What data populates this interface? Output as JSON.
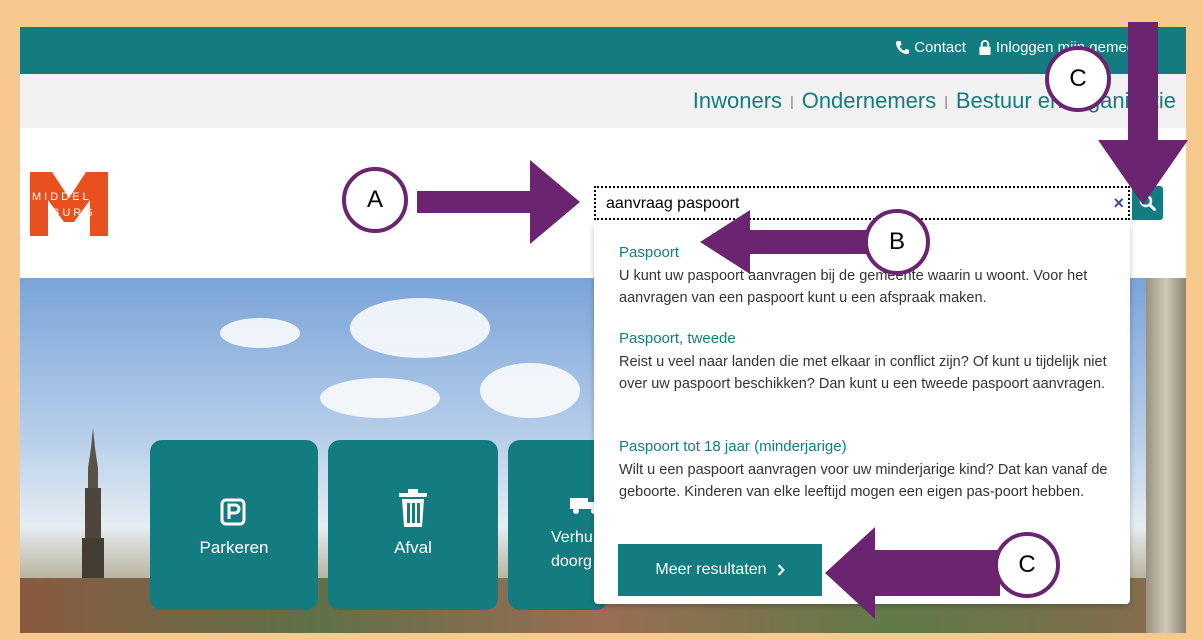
{
  "topbar": {
    "contact": "Contact",
    "login": "Inloggen mijn gemeente"
  },
  "nav": {
    "items": [
      "Inwoners",
      "Ondernemers",
      "Bestuur en organisatie"
    ]
  },
  "logo": {
    "letter": "M",
    "top_text": "MIDDEL",
    "bottom_text": "BURG"
  },
  "search": {
    "value": "aanvraag paspoort",
    "clear_icon": "×"
  },
  "results": [
    {
      "title": "Paspoort",
      "desc": "U kunt uw paspoort aanvragen bij de gemeente waarin u woont. Voor het aanvragen van een paspoort kunt u een afspraak maken."
    },
    {
      "title": "Paspoort, tweede",
      "desc": "Reist u veel naar landen die met elkaar in conflict zijn? Of kunt u tijdelijk niet over uw paspoort beschikken? Dan kunt u een tweede paspoort aanvragen."
    },
    {
      "title": "Paspoort tot 18 jaar (minderjarige)",
      "desc": "Wilt u een paspoort aanvragen voor uw minderjarige kind? Dat kan vanaf de geboorte. Kinderen van elke leeftijd mogen een eigen pas-poort hebben."
    }
  ],
  "more_button": "Meer resultaten",
  "tiles": {
    "parking": "Parkeren",
    "waste": "Afval",
    "moving_1": "Verhu",
    "moving_2": "doorg"
  },
  "annotations": {
    "a": "A",
    "b": "B",
    "c1": "C",
    "c2": "C"
  },
  "colors": {
    "brand": "#137c80",
    "logo": "#e8501f",
    "annotation": "#6b2470"
  }
}
